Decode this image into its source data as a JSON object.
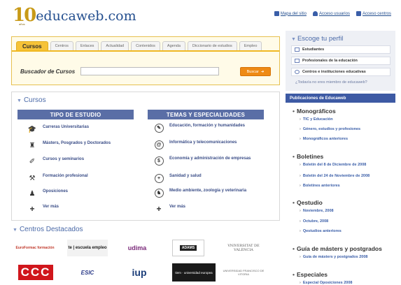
{
  "header": {
    "logo_number": "10",
    "logo_name": "educaweb.com",
    "logo_sub": "años",
    "links": [
      {
        "label": "Mapa del sitio",
        "icon": "sitemap-icon"
      },
      {
        "label": "Acceso usuarios",
        "icon": "user-icon"
      },
      {
        "label": "Acceso centros",
        "icon": "monitor-icon"
      }
    ]
  },
  "tabs": [
    {
      "label": "Cursos",
      "active": true
    },
    {
      "label": "Centros"
    },
    {
      "label": "Enlaces"
    },
    {
      "label": "Actualidad"
    },
    {
      "label": "Contenidos"
    },
    {
      "label": "Agenda"
    },
    {
      "label": "Diccionario de estudios"
    },
    {
      "label": "Empleo"
    }
  ],
  "search": {
    "label": "Buscador de Cursos",
    "placeholder": "",
    "button": "Buscar"
  },
  "cursos": {
    "title": "Cursos",
    "col_left_title": "TIPO DE ESTUDIO",
    "col_right_title": "TEMAS Y ESPECIALIDADES",
    "left_items": [
      {
        "label": "Carreras Universitarias",
        "icon": "graduation-icon"
      },
      {
        "label": "Másters, Posgrados y Doctorados",
        "icon": "graduate-person-icon"
      },
      {
        "label": "Cursos y seminarios",
        "icon": "pencil-icon"
      },
      {
        "label": "Formación profesional",
        "icon": "tools-icon"
      },
      {
        "label": "Oposiciones",
        "icon": "stamp-icon"
      },
      {
        "label": "Ver más",
        "icon": "plus-icon"
      }
    ],
    "right_items": [
      {
        "label": "Educación, formación y humanidades",
        "icon": "pen-circle-icon",
        "glyph": "✎"
      },
      {
        "label": "Informática y telecomunicaciones",
        "icon": "at-circle-icon",
        "glyph": "@"
      },
      {
        "label": "Economía y administración de empresas",
        "icon": "dollar-circle-icon",
        "glyph": "$"
      },
      {
        "label": "Sanidad y salud",
        "icon": "medical-circle-icon",
        "glyph": "+"
      },
      {
        "label": "Medio ambiente, zoología y veterinaria",
        "icon": "animal-circle-icon",
        "glyph": "♞"
      },
      {
        "label": "Ver más",
        "icon": "plus-icon",
        "glyph": "+"
      }
    ]
  },
  "centros": {
    "title": "Centros Destacados",
    "logos": [
      {
        "text": "EuroFormac formación",
        "color": "#c0392b"
      },
      {
        "text": "te | escuela empleo",
        "color": "#1a1a1a"
      },
      {
        "text": "udima",
        "color": "#7b2a7a"
      },
      {
        "text": "ADAMS",
        "color": "#222222"
      },
      {
        "text": "VNIVERSITAT DE VALÈNCIA",
        "color": "#555555"
      },
      {
        "text": "CCC",
        "color": "#d0161c"
      },
      {
        "text": "ESIC",
        "color": "#2d3c8a"
      },
      {
        "text": "iup",
        "color": "#1d3f7a"
      },
      {
        "text": "tiem · universidad europea",
        "color": "#333333"
      },
      {
        "text": "UNIVERSIDAD FRANCISCO DE VITORIA",
        "color": "#666666"
      }
    ]
  },
  "perfil": {
    "title": "Escoge tu perfil",
    "items": [
      "Estudiantes",
      "Profesionales de la educación",
      "Centros e instituciones educativas"
    ],
    "link": "¿Todavía no eres miembro de educaweb?"
  },
  "publicaciones": {
    "header": "Publicaciones de Educaweb",
    "groups": [
      {
        "title": "Monográficos",
        "items": [
          "TIC y Educación",
          "Género, estudios y profesiones",
          "Monográficos anteriores"
        ]
      },
      {
        "title": "Boletines",
        "items": [
          "Boletín del 8 de Diciembre de 2008",
          "Boletín del 24 de Noviembre de 2008",
          "Boletines anteriores"
        ]
      },
      {
        "title": "Qestudio",
        "items": [
          "Noviembre, 2008",
          "Octubre, 2008",
          "Qestudios anteriores"
        ]
      },
      {
        "title": "Guía de másters y postgrados",
        "items": [
          "Guía de másters y postgrados 2008"
        ]
      },
      {
        "title": "Especiales",
        "items": [
          "Especial Oposiciones 2008"
        ]
      }
    ]
  },
  "colors": {
    "brand_blue": "#3d5aa4",
    "tab_yellow": "#f6c338",
    "button_orange": "#ee8a14",
    "column_header": "#5a6ea6"
  }
}
